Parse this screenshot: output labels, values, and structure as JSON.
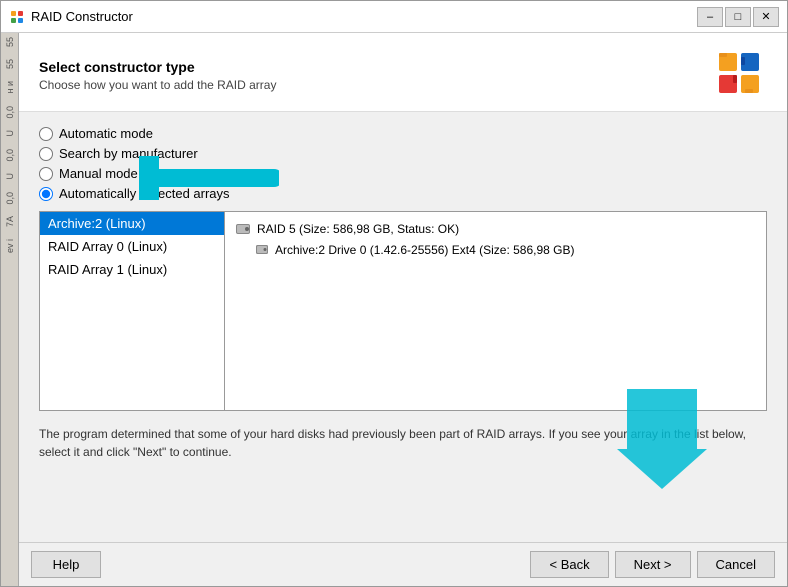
{
  "window": {
    "title": "RAID Constructor",
    "titlebar_controls": [
      "minimize",
      "maximize",
      "close"
    ]
  },
  "header": {
    "title": "Select constructor type",
    "subtitle": "Choose how you want to add the RAID array"
  },
  "radio_options": [
    {
      "id": "auto",
      "label": "Automatic mode",
      "checked": false
    },
    {
      "id": "manufacturer",
      "label": "Search by manufacturer",
      "checked": false
    },
    {
      "id": "manual",
      "label": "Manual mode",
      "checked": false
    },
    {
      "id": "auto_detected",
      "label": "Automatically detected arrays",
      "checked": true
    }
  ],
  "left_list": {
    "items": [
      {
        "label": "Archive:2 (Linux)",
        "selected": true
      },
      {
        "label": "RAID Array 0 (Linux)",
        "selected": false
      },
      {
        "label": "RAID Array 1 (Linux)",
        "selected": false
      }
    ]
  },
  "right_panel": {
    "items": [
      {
        "label": "RAID 5 (Size: 586,98 GB, Status: OK)",
        "icon": "drive",
        "children": [
          {
            "label": "Archive:2 Drive 0 (1.42.6-25556) Ext4 (Size: 586,98 GB)",
            "icon": "drive-small"
          }
        ]
      }
    ]
  },
  "info_text": "The program determined that some of your hard disks had previously been part of RAID arrays. If you see your array in the list below, select it and click \"Next\" to continue.",
  "footer": {
    "help_label": "Help",
    "back_label": "< Back",
    "next_label": "Next >",
    "cancel_label": "Cancel"
  },
  "sidebar_items": [
    "55",
    "55",
    "н и",
    "7A",
    "ev i"
  ],
  "colors": {
    "selected_bg": "#0078d7",
    "arrow_color": "#00bcd4"
  }
}
